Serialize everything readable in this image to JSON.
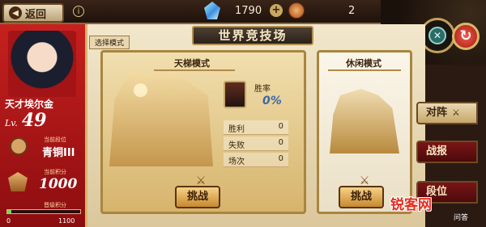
{
  "topbar": {
    "back_label": "返回",
    "gems": "1790",
    "tokens": "2"
  },
  "profile": {
    "name": "天才埃尔金",
    "level_label": "Lv.",
    "level": "49",
    "rank_label": "当前段位",
    "rank": "青铜III",
    "points_label": "当前积分",
    "points": "1000",
    "next_label": "晋级积分",
    "progress_min": "0",
    "progress_max": "1100",
    "progress_fraction": 0.0
  },
  "header": {
    "mode_select": "选择模式",
    "title": "世界竞技场"
  },
  "ladder": {
    "title": "天梯模式",
    "winrate_label": "胜率",
    "winrate": "0%",
    "stats": [
      {
        "label": "胜利",
        "value": "0"
      },
      {
        "label": "失败",
        "value": "0"
      },
      {
        "label": "场次",
        "value": "0"
      }
    ],
    "challenge_label": "挑战"
  },
  "casual": {
    "title": "休闲模式",
    "challenge_label": "挑战"
  },
  "side_tabs": {
    "opponent": "对阵",
    "report": "战报",
    "rank": "段位"
  },
  "watermark": {
    "text": "锐客网",
    "sub": "问答"
  }
}
